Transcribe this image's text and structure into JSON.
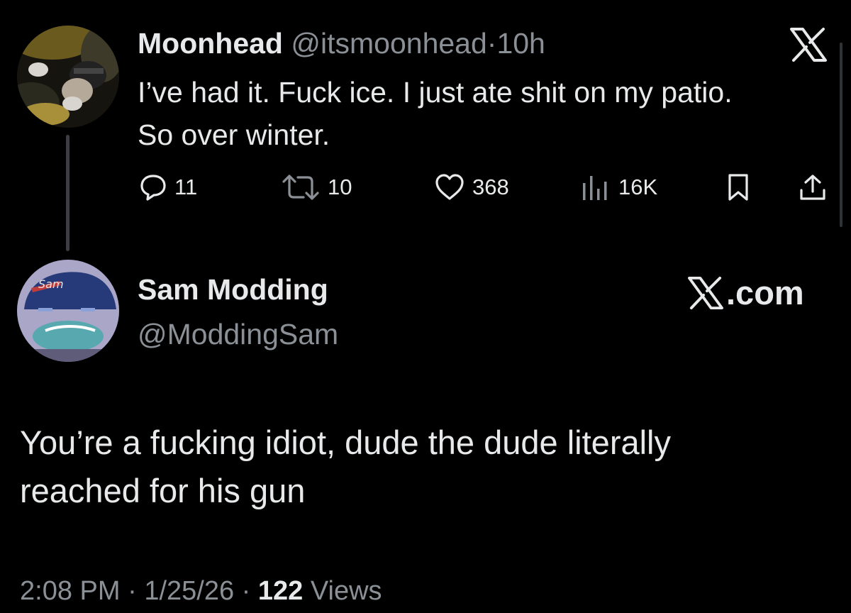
{
  "parent_tweet": {
    "author_name": "Moonhead",
    "handle": "@itsmoonhead",
    "separator": "·",
    "time": "10h",
    "text_line1": "I’ve had it. Fuck ice. I just ate shit on my patio.",
    "text_line2": "So over winter.",
    "replies": "11",
    "reposts": "10",
    "likes": "368",
    "views": "16K",
    "avatar_icon": "avatar-photo",
    "platform_icon": "x-logo-icon"
  },
  "reply_tweet": {
    "author_name": "Sam Modding",
    "handle": "@ModdingSam",
    "platform_label": ".com",
    "text_line1": "You’re a fucking idiot, dude the dude literally",
    "text_line2": "reached for his gun",
    "avatar_icon": "avatar-cartoon"
  },
  "footer": {
    "time": "2:08 PM",
    "sep1": " · ",
    "date": "1/25/26",
    "sep2": " · ",
    "views_count": "122",
    "views_label": " Views"
  },
  "colors": {
    "background": "#000000",
    "primary_text": "#e7e9ea",
    "secondary_text": "#8b9096",
    "thread_line": "#3b3e43"
  }
}
